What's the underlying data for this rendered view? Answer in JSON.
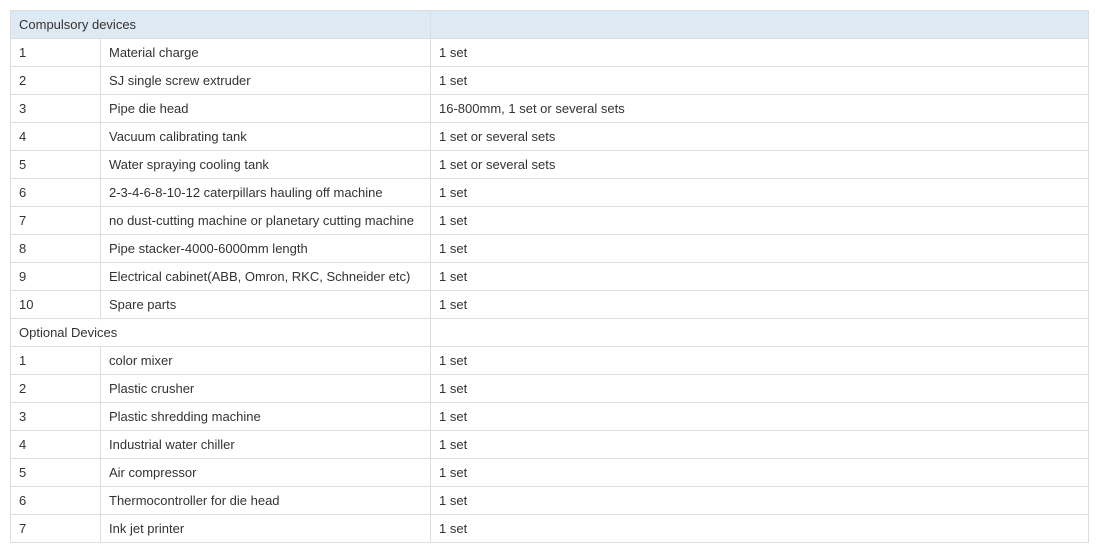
{
  "section1": {
    "title": "Compulsory devices",
    "rows": [
      {
        "num": "1",
        "name": "Material charge",
        "qty": "1 set"
      },
      {
        "num": "2",
        "name": "SJ single screw extruder",
        "qty": "1 set"
      },
      {
        "num": "3",
        "name": "Pipe die head",
        "qty": "16-800mm, 1 set or several sets"
      },
      {
        "num": "4",
        "name": "Vacuum calibrating tank",
        "qty": "1 set or several sets"
      },
      {
        "num": "5",
        "name": "Water spraying cooling tank",
        "qty": "1 set or several sets"
      },
      {
        "num": "6",
        "name": "2-3-4-6-8-10-12 caterpillars hauling off machine",
        "qty": "1 set"
      },
      {
        "num": "7",
        "name": "no dust-cutting machine or planetary cutting machine",
        "qty": "1 set"
      },
      {
        "num": "8",
        "name": "Pipe stacker-4000-6000mm length",
        "qty": "1 set"
      },
      {
        "num": "9",
        "name": "Electrical cabinet(ABB, Omron, RKC, Schneider etc)",
        "qty": "1 set"
      },
      {
        "num": "10",
        "name": "Spare parts",
        "qty": "1 set"
      }
    ]
  },
  "section2": {
    "title": "Optional Devices",
    "rows": [
      {
        "num": "1",
        "name": "color mixer",
        "qty": "1 set"
      },
      {
        "num": "2",
        "name": "Plastic crusher",
        "qty": "1 set"
      },
      {
        "num": "3",
        "name": "Plastic shredding machine",
        "qty": "1 set"
      },
      {
        "num": "4",
        "name": "Industrial water chiller",
        "qty": "1 set"
      },
      {
        "num": "5",
        "name": "Air compressor",
        "qty": "1 set"
      },
      {
        "num": "6",
        "name": "Thermocontroller for die head",
        "qty": "1 set"
      },
      {
        "num": "7",
        "name": "Ink jet printer",
        "qty": "1 set"
      }
    ]
  }
}
